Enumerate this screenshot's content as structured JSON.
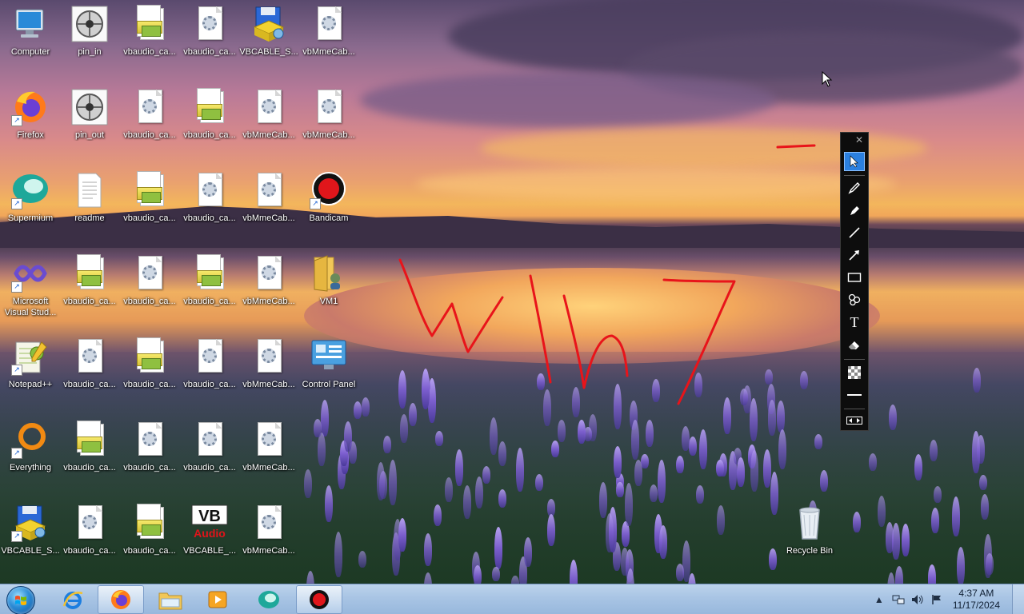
{
  "desktop": {
    "icons": [
      {
        "label": "Computer",
        "kind": "computer"
      },
      {
        "label": "pin_in",
        "kind": "reel"
      },
      {
        "label": "vbaudio_ca...",
        "kind": "stack"
      },
      {
        "label": "vbaudio_ca...",
        "kind": "gear"
      },
      {
        "label": "VBCABLE_S...",
        "kind": "vbsetup"
      },
      {
        "label": "vbMmeCab...",
        "kind": "gear"
      },
      {
        "label": "Firefox",
        "kind": "firefox"
      },
      {
        "label": "pin_out",
        "kind": "reel"
      },
      {
        "label": "vbaudio_ca...",
        "kind": "gear"
      },
      {
        "label": "vbaudio_ca...",
        "kind": "stack"
      },
      {
        "label": "vbMmeCab...",
        "kind": "gear"
      },
      {
        "label": "vbMmeCab...",
        "kind": "gear"
      },
      {
        "label": "Supermium",
        "kind": "supermium"
      },
      {
        "label": "readme",
        "kind": "text"
      },
      {
        "label": "vbaudio_ca...",
        "kind": "stack"
      },
      {
        "label": "vbaudio_ca...",
        "kind": "gear"
      },
      {
        "label": "vbMmeCab...",
        "kind": "gear"
      },
      {
        "label": "Bandicam",
        "kind": "bandicam"
      },
      {
        "label": "Microsoft Visual Stud...",
        "kind": "vs"
      },
      {
        "label": "vbaudio_ca...",
        "kind": "stack"
      },
      {
        "label": "vbaudio_ca...",
        "kind": "gear"
      },
      {
        "label": "vbaudio_ca...",
        "kind": "stack"
      },
      {
        "label": "vbMmeCab...",
        "kind": "gear"
      },
      {
        "label": "VM1",
        "kind": "folder"
      },
      {
        "label": "Notepad++",
        "kind": "notepad"
      },
      {
        "label": "vbaudio_ca...",
        "kind": "gear"
      },
      {
        "label": "vbaudio_ca...",
        "kind": "stack"
      },
      {
        "label": "vbaudio_ca...",
        "kind": "gear"
      },
      {
        "label": "vbMmeCab...",
        "kind": "gear"
      },
      {
        "label": "Control Panel",
        "kind": "controlpanel"
      },
      {
        "label": "Everything",
        "kind": "everything"
      },
      {
        "label": "vbaudio_ca...",
        "kind": "stack"
      },
      {
        "label": "vbaudio_ca...",
        "kind": "gear"
      },
      {
        "label": "vbaudio_ca...",
        "kind": "gear"
      },
      {
        "label": "vbMmeCab...",
        "kind": "gear"
      },
      {
        "label": "VBCABLE_S...",
        "kind": "vbsetup"
      },
      {
        "label": "vbaudio_ca...",
        "kind": "gear"
      },
      {
        "label": "vbaudio_ca...",
        "kind": "stack"
      },
      {
        "label": "VBCABLE_...",
        "kind": "vbaudio"
      },
      {
        "label": "vbMmeCab...",
        "kind": "gear"
      }
    ],
    "recycle_bin": {
      "label": "Recycle Bin"
    }
  },
  "annotation_toolbar": {
    "close": "✕",
    "tools": [
      "pointer-icon",
      "pen-icon",
      "highlighter-icon",
      "line-icon",
      "arrow-icon",
      "rectangle-icon",
      "stamp-icon",
      "text-icon",
      "eraser-icon",
      "transparency-icon",
      "thickness-icon",
      "expand-icon"
    ],
    "text_tool_glyph": "T"
  },
  "taskbar": {
    "pinned": [
      "internet-explorer",
      "firefox",
      "explorer",
      "media-player",
      "supermium",
      "bandicam"
    ],
    "clock_time": "4:37 AM",
    "clock_date": "11/17/2024"
  },
  "colors": {
    "ink": "#e8141a",
    "toolbar_active": "#2b80e0",
    "taskbar_top": "#bcd3ec"
  }
}
